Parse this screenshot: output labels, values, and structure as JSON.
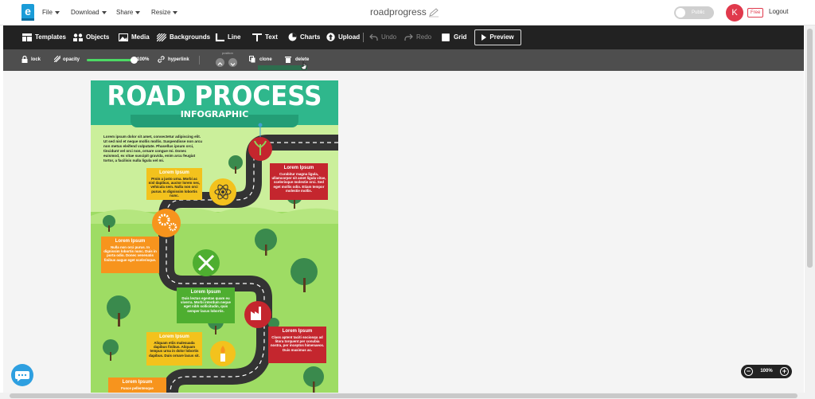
{
  "topbar": {
    "logo_letter": "e",
    "menus": [
      "File",
      "Download",
      "Share",
      "Resize"
    ],
    "doc_title": "roadprogress",
    "visibility_label": "Public",
    "avatar_initial": "K",
    "plan_badge": "Free",
    "logout_label": "Logout"
  },
  "toolbar": {
    "templates": "Templates",
    "objects": "Objects",
    "media": "Media",
    "backgrounds": "Backgrounds",
    "line": "Line",
    "text": "Text",
    "charts": "Charts",
    "upload": "Upload",
    "undo": "Undo",
    "redo": "Redo",
    "grid": "Grid",
    "preview": "Preview"
  },
  "subbar": {
    "lock": "lock",
    "opacity": "opacity",
    "opacity_value": "100%",
    "opacity_fraction": 1.0,
    "hyperlink": "hyperlink",
    "position": "position",
    "clone": "clone",
    "delete": "delete"
  },
  "infographic": {
    "title": "ROAD PROCESS",
    "subtitle": "INFOGRAPHIC",
    "intro": "Lorem ipsum dolor sit amet, consectetur adipiscing elit. Ut sed nisl et neque mollis mollis. Suspendisse non arcu non metus eleifend vulputate. Phasellus ipsum orci, tincidunt vel orci non, ornare congue mi. Donec euismod, ex vitae suscipit gravida, enim arcu feugiat tortor, a facilisis nulla ligula vel mi.",
    "boxes": [
      {
        "title": "Lorem Ipsum",
        "body": "Proin a justo urna. Morbi ac nisl dapibus, auctor lorem nec, vehicula sem. Nulla non orci purus. In dignissim lobortis nunc."
      },
      {
        "title": "Lorem Ipsum",
        "body": "Curabitur magna ligula, ullamcorper sit amet ligula vitae, scelerisque molestie orci. Sed eget mollis odio. Etiam tempor molestie mollis."
      },
      {
        "title": "Lorem Ipsum",
        "body": "Nulla non orci purus. In dignissim lobortis nunc. Duis in porta odio. Donec venenatis finibus augue eget scelerisque."
      },
      {
        "title": "Lorem Ipsum",
        "body": "Duis lectus egestas quam eu viverra. Morbi interdum neque eget nibh sollicitudin, quis semper lacus lobortis."
      },
      {
        "title": "Lorem Ipsum",
        "body": "Aliquam etiis malesuada dapibus finibus. Aliquam tempus urna in dolor lobortis dapibus. Duis ornare lacus sit."
      },
      {
        "title": "Lorem Ipsum",
        "body": "Class aptent taciti sociosqu ad litora torquent per conubia nostra, per inceptos himenaeos. Duis maximus ac."
      },
      {
        "title": "Lorem Ipsum",
        "body": "Fusce pellentesque"
      }
    ]
  },
  "zoom": {
    "level": "100%",
    "minus": "−",
    "plus": "+"
  },
  "colors": {
    "accent_green": "#2fb78c",
    "toolbar_bg": "#222222",
    "avatar_red": "#e0394c"
  }
}
